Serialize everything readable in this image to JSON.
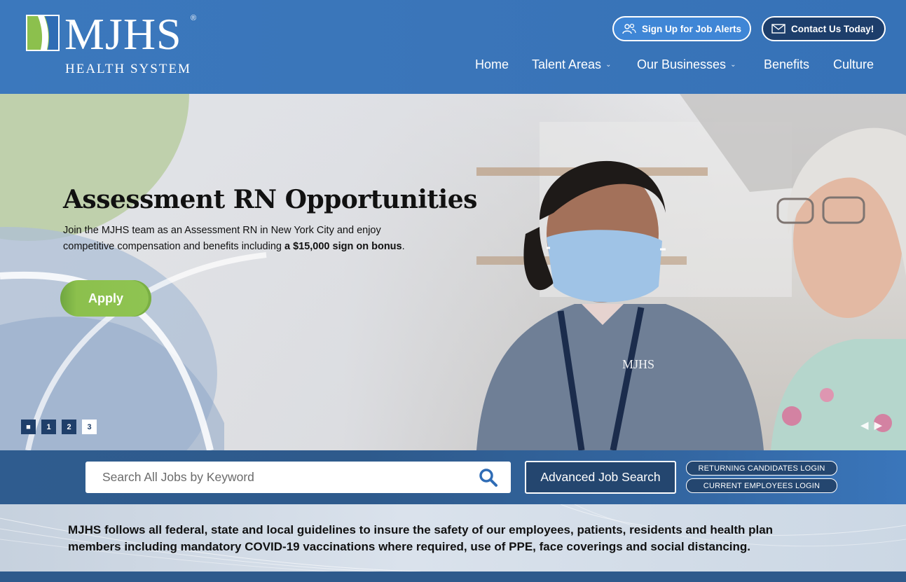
{
  "brand": {
    "name": "MJHS",
    "registered": "®",
    "subtitle": "HEALTH SYSTEM",
    "colors": {
      "header_blue": "#3a75b9",
      "navy": "#24466f",
      "green": "#8cc04d"
    }
  },
  "header": {
    "alerts_button": {
      "label": "Sign Up for Job Alerts",
      "icon": "users-icon"
    },
    "contact_button": {
      "label": "Contact Us Today!",
      "icon": "envelope-icon"
    },
    "nav": [
      {
        "label": "Home",
        "has_dropdown": false
      },
      {
        "label": "Talent Areas",
        "has_dropdown": true
      },
      {
        "label": "Our Businesses",
        "has_dropdown": true
      },
      {
        "label": "Benefits",
        "has_dropdown": false
      },
      {
        "label": "Culture",
        "has_dropdown": false
      }
    ]
  },
  "hero": {
    "title": "Assessment RN Opportunities",
    "text_before": "Join the MJHS team as an Assessment RN in New York City and enjoy competitive compensation and benefits including ",
    "text_bold": "a $15,000 sign on bonus",
    "text_after": ".",
    "apply_label": "Apply",
    "badge_text": "MJHS",
    "slides": [
      {
        "label": "■",
        "active": false
      },
      {
        "label": "1",
        "active": false
      },
      {
        "label": "2",
        "active": false
      },
      {
        "label": "3",
        "active": true
      }
    ],
    "prev_arrow": "◀",
    "next_arrow": "▶"
  },
  "search": {
    "placeholder": "Search All Jobs by Keyword",
    "value": "",
    "search_icon": "search-icon",
    "advanced_label": "Advanced Job Search",
    "returning_login": "RETURNING CANDIDATES LOGIN",
    "employees_login": "CURRENT EMPLOYEES LOGIN"
  },
  "notice": {
    "text": "MJHS follows all federal, state and local guidelines to insure the safety of our employees, patients, residents and health plan members including mandatory COVID-19 vaccinations where required, use of PPE, face coverings and social distancing."
  }
}
